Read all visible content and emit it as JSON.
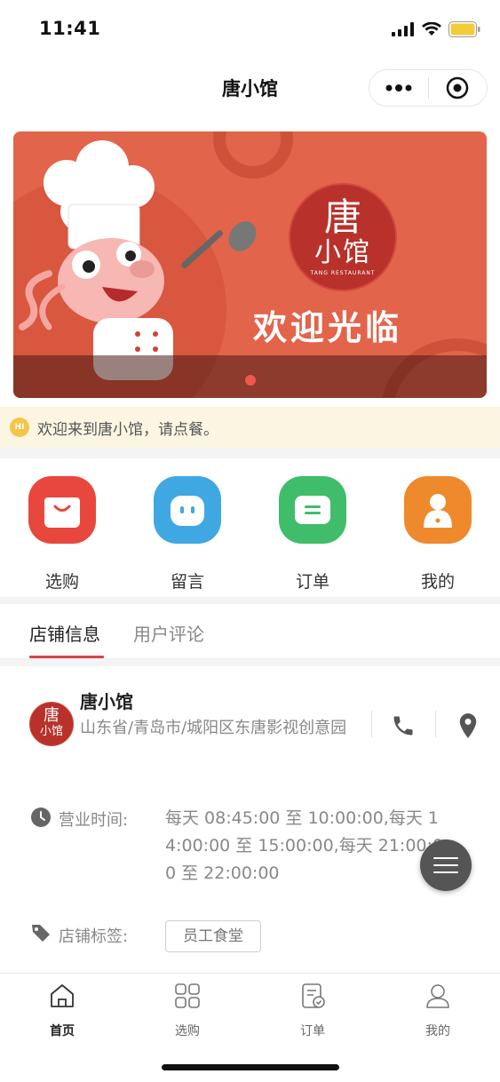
{
  "status_bar": {
    "time": "11:41"
  },
  "nav": {
    "title": "唐小馆",
    "more_icon": "more-dots-icon",
    "close_icon": "target-icon"
  },
  "banner": {
    "logo_text_main": "唐",
    "logo_text_sub": "小馆",
    "logo_text_en": "TANG RESTAURANT",
    "welcome": "欢迎光临",
    "slide_count": 1,
    "active_slide": 1
  },
  "notice": {
    "icon": "HI",
    "text": "欢迎来到唐小馆，请点餐。"
  },
  "quick_actions": [
    {
      "label": "选购",
      "icon": "shopping-bag-icon",
      "color": "#e8473d"
    },
    {
      "label": "留言",
      "icon": "message-face-icon",
      "color": "#3fa8e3"
    },
    {
      "label": "订单",
      "icon": "ticket-icon",
      "color": "#3fbd6a"
    },
    {
      "label": "我的",
      "icon": "person-icon",
      "color": "#ee8a2b"
    }
  ],
  "tabs": {
    "active": "店铺信息",
    "inactive": "用户评论"
  },
  "store": {
    "name": "唐小馆",
    "address": "山东省/青岛市/城阳区东唐影视创意园",
    "logo_main": "唐",
    "logo_sub": "小馆",
    "hours_label": "营业时间:",
    "hours": "每天 08:45:00 至 10:00:00,每天 14:00:00 至 15:00:00,每天 21:00:00 至 22:00:00",
    "tag_label": "店铺标签:",
    "tag": "员工食堂"
  },
  "tabbar": [
    {
      "label": "首页",
      "icon": "home-icon",
      "active": true
    },
    {
      "label": "选购",
      "icon": "grid-icon",
      "active": false
    },
    {
      "label": "订单",
      "icon": "order-icon",
      "active": false
    },
    {
      "label": "我的",
      "icon": "user-icon",
      "active": false
    }
  ],
  "colors": {
    "accent": "#d9444b",
    "banner_bg": "#e2644b",
    "notice_bg": "#fbf5e2"
  }
}
